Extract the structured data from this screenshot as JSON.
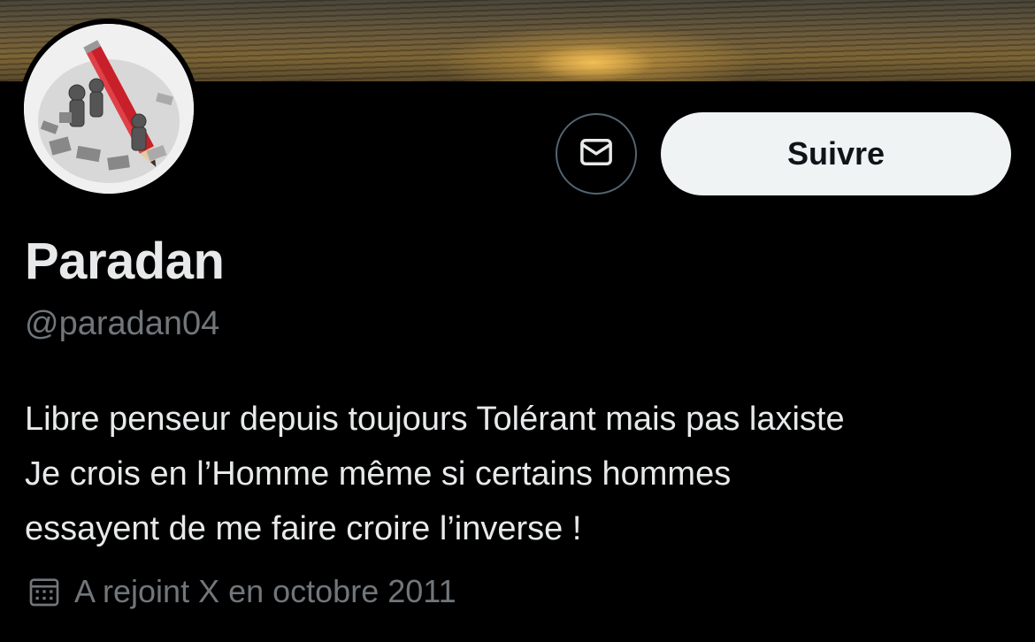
{
  "profile": {
    "display_name": "Paradan",
    "handle": "@paradan04",
    "bio_lines": [
      "Libre penseur depuis toujours Tolérant mais pas laxiste",
      "Je crois en l’Homme même si certains hommes",
      "essayent de me faire croire l’inverse !"
    ],
    "joined": "A rejoint X en octobre 2011"
  },
  "actions": {
    "follow_label": "Suivre"
  },
  "icons": {
    "message": "envelope-icon",
    "joined": "calendar-icon"
  },
  "colors": {
    "background": "#000000",
    "primary_text": "#e7e9ea",
    "secondary_text": "#71767b",
    "follow_button_bg": "#eff3f4",
    "follow_button_text": "#0f1419",
    "button_border": "#536471"
  }
}
